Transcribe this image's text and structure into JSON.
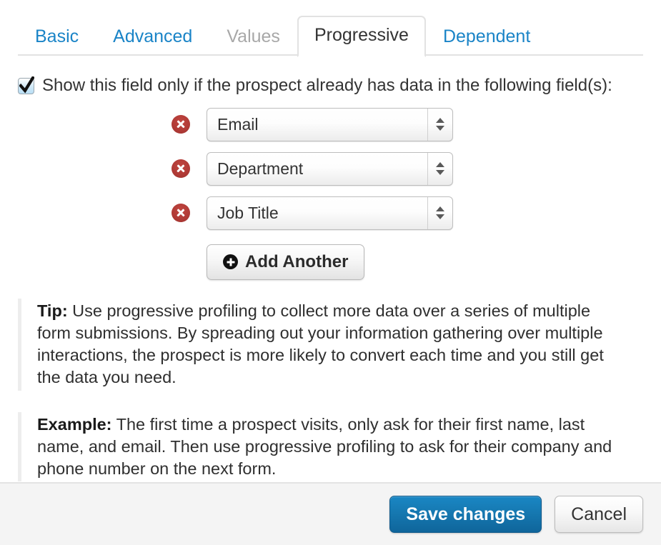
{
  "tabs": [
    {
      "label": "Basic",
      "state": "link"
    },
    {
      "label": "Advanced",
      "state": "link"
    },
    {
      "label": "Values",
      "state": "disabled"
    },
    {
      "label": "Progressive",
      "state": "active"
    },
    {
      "label": "Dependent",
      "state": "link"
    }
  ],
  "checkbox": {
    "checked": true,
    "label": "Show this field only if the prospect already has data in the following field(s):"
  },
  "fields": [
    {
      "value": "Email",
      "remove_label": "Remove field"
    },
    {
      "value": "Department",
      "remove_label": "Remove field"
    },
    {
      "value": "Job Title",
      "remove_label": "Remove field"
    }
  ],
  "add_another": {
    "label": "Add Another",
    "icon": "plus-circle-icon"
  },
  "notes": [
    {
      "heading": "Tip:",
      "text": " Use progressive profiling to collect more data over a series of multiple form submissions. By spreading out your information gathering over multiple interactions, the prospect is more likely to convert each time and you still get the data you need."
    },
    {
      "heading": "Example:",
      "text": " The first time a prospect visits, only ask for their first name, last name, and email. Then use progressive profiling to ask for their company and phone number on the next form."
    }
  ],
  "footer": {
    "save_label": "Save changes",
    "cancel_label": "Cancel"
  },
  "colors": {
    "tab_link": "#1a84c7",
    "tab_disabled": "#a8a8a8",
    "tab_active_text": "#333333",
    "remove_icon": "#b03a36",
    "primary_button": "#1576ae",
    "footer_bg": "#f4f4f4",
    "note_bar": "#ededed"
  }
}
